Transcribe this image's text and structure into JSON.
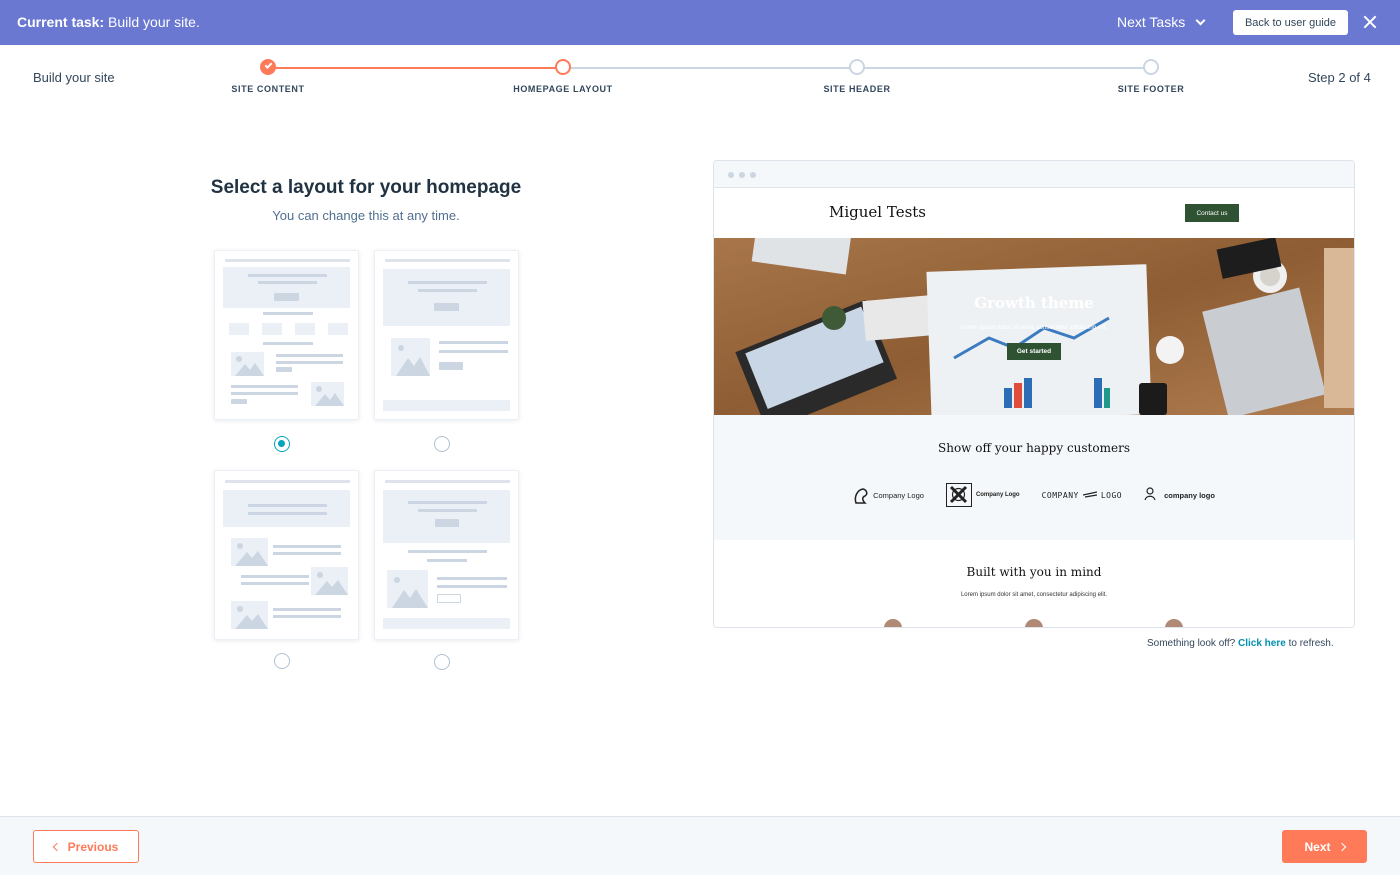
{
  "topbar": {
    "task_prefix": "Current task:",
    "task_text": " Build your site.",
    "next_tasks_label": "Next Tasks",
    "guide_button": "Back to user guide",
    "background_color": "#6a78d1"
  },
  "stepper": {
    "title": "Build your site",
    "step_count": "Step 2 of 4",
    "steps": [
      {
        "label": "SITE CONTENT",
        "state": "done"
      },
      {
        "label": "HOMEPAGE LAYOUT",
        "state": "current"
      },
      {
        "label": "SITE HEADER",
        "state": "todo"
      },
      {
        "label": "SITE FOOTER",
        "state": "todo"
      }
    ],
    "accent_color": "#ff7a59"
  },
  "layout_picker": {
    "heading": "Select a layout for your homepage",
    "subheading": "You can change this at any time.",
    "selected_index": 0,
    "options_count": 4
  },
  "preview": {
    "site_name": "Miguel Tests",
    "contact_button": "Contact us",
    "hero_title": "Growth theme",
    "hero_subtitle": "Lorem ipsum dolor sit amet, consectetur adipiscing elit.",
    "hero_button": "Get started",
    "customers_title": "Show off your happy customers",
    "logos": [
      "Company Logo",
      "Company Logo",
      "COMPANY",
      "LOGO",
      "company logo"
    ],
    "built_title": "Built with you in mind",
    "built_subtitle": "Lorem ipsum dolor sit amet, consectetur adipiscing elit."
  },
  "refresh": {
    "prefix": "Something look off? ",
    "link": "Click here",
    "suffix": " to refresh."
  },
  "footer": {
    "previous_label": "Previous",
    "next_label": "Next"
  }
}
